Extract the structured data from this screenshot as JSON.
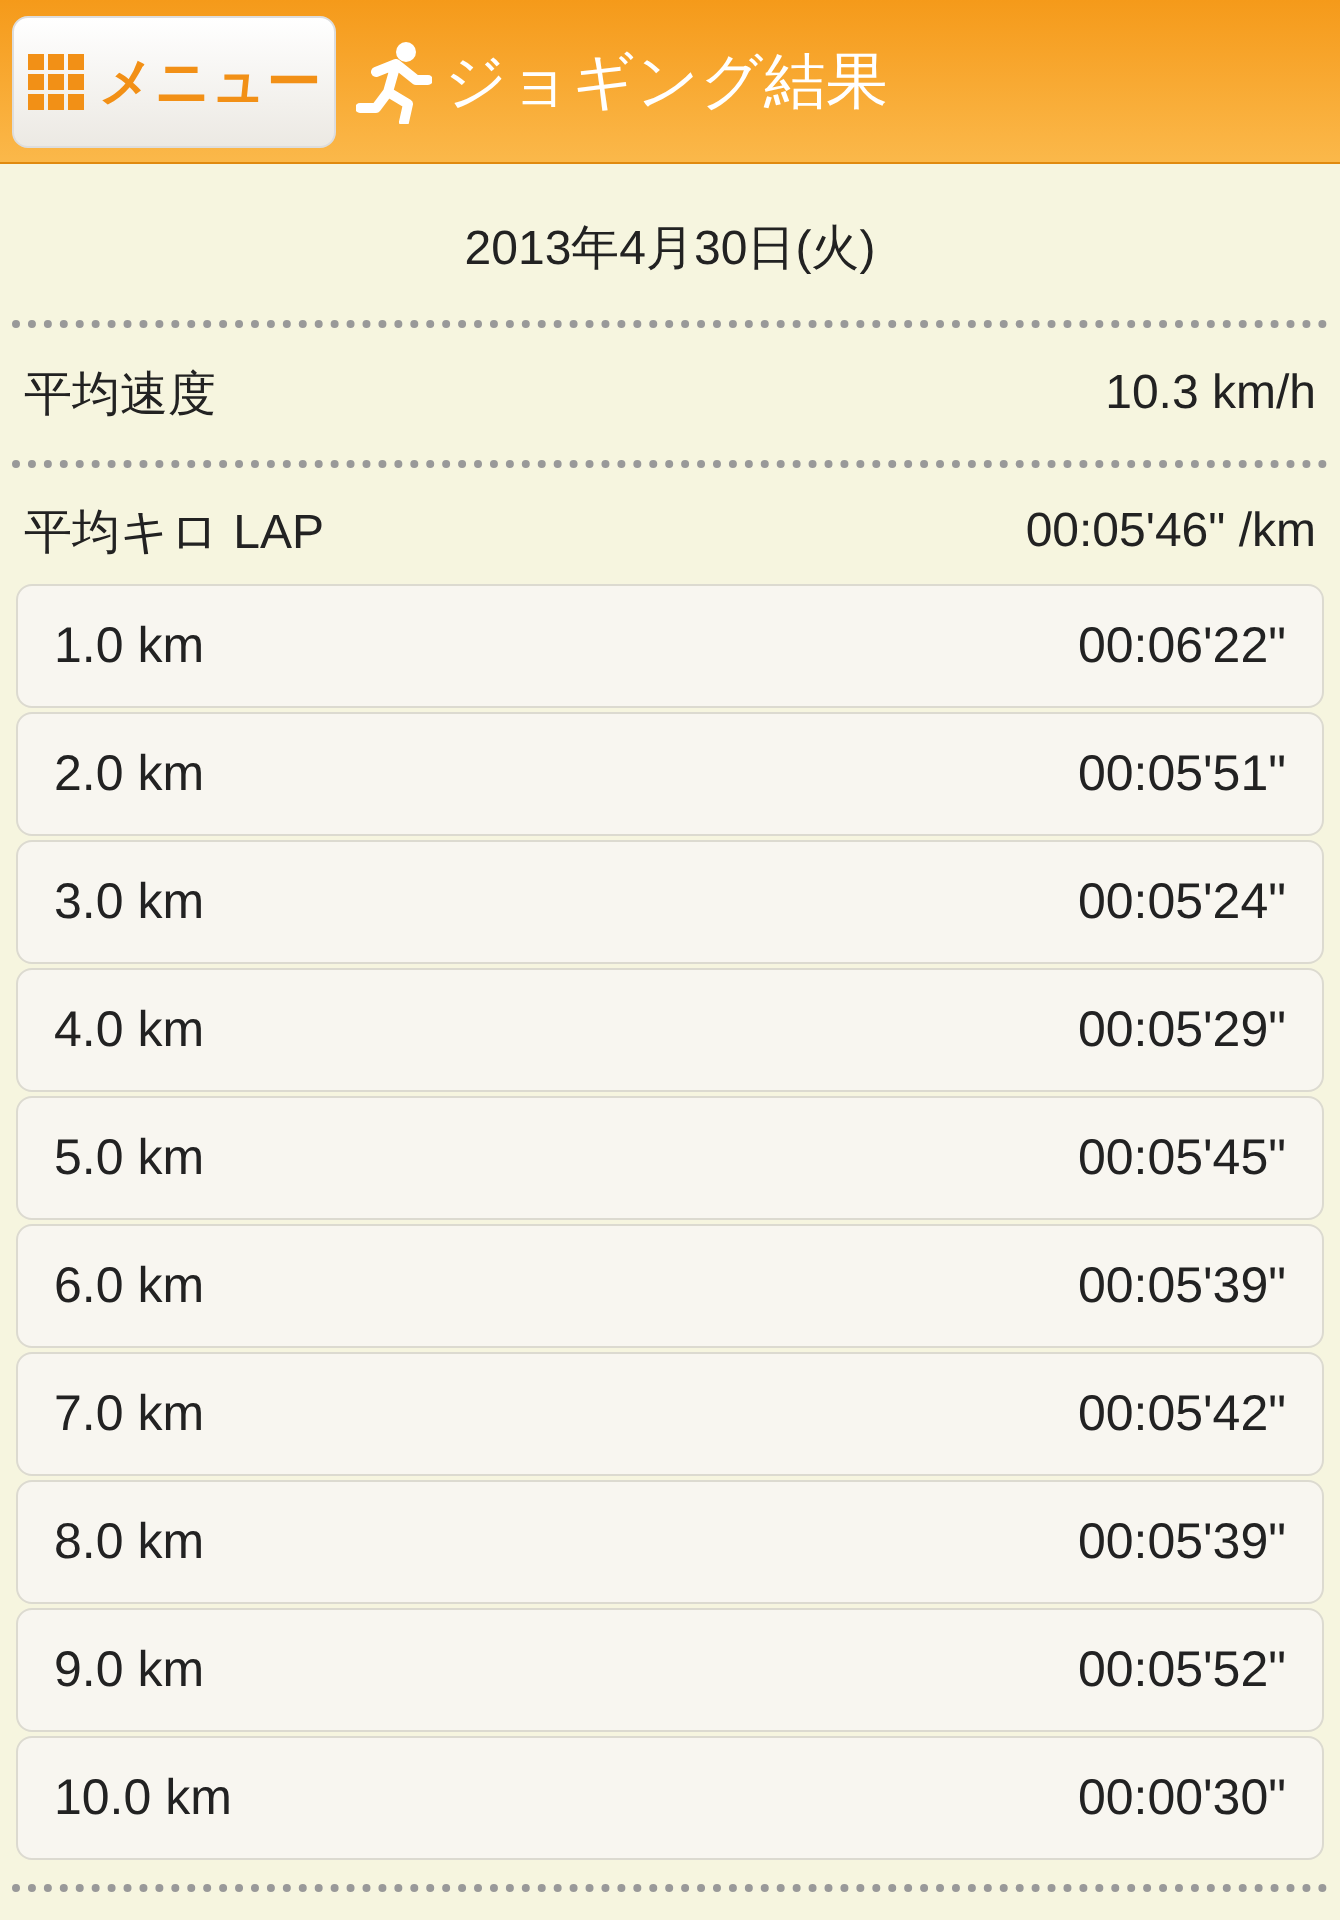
{
  "header": {
    "menu_button": "メニュー",
    "title": "ジョギング結果"
  },
  "date": "2013年4月30日(火)",
  "average_speed": {
    "label": "平均速度",
    "value": "10.3 km/h"
  },
  "average_lap": {
    "label": "平均キロ LAP",
    "value": "00:05'46\" /km"
  },
  "laps": [
    {
      "distance": "1.0 km",
      "time": "00:06'22\""
    },
    {
      "distance": "2.0 km",
      "time": "00:05'51\""
    },
    {
      "distance": "3.0 km",
      "time": "00:05'24\""
    },
    {
      "distance": "4.0 km",
      "time": "00:05'29\""
    },
    {
      "distance": "5.0 km",
      "time": "00:05'45\""
    },
    {
      "distance": "6.0 km",
      "time": "00:05'39\""
    },
    {
      "distance": "7.0 km",
      "time": "00:05'42\""
    },
    {
      "distance": "8.0 km",
      "time": "00:05'39\""
    },
    {
      "distance": "9.0 km",
      "time": "00:05'52\""
    },
    {
      "distance": "10.0 km",
      "time": "00:00'30\""
    }
  ]
}
